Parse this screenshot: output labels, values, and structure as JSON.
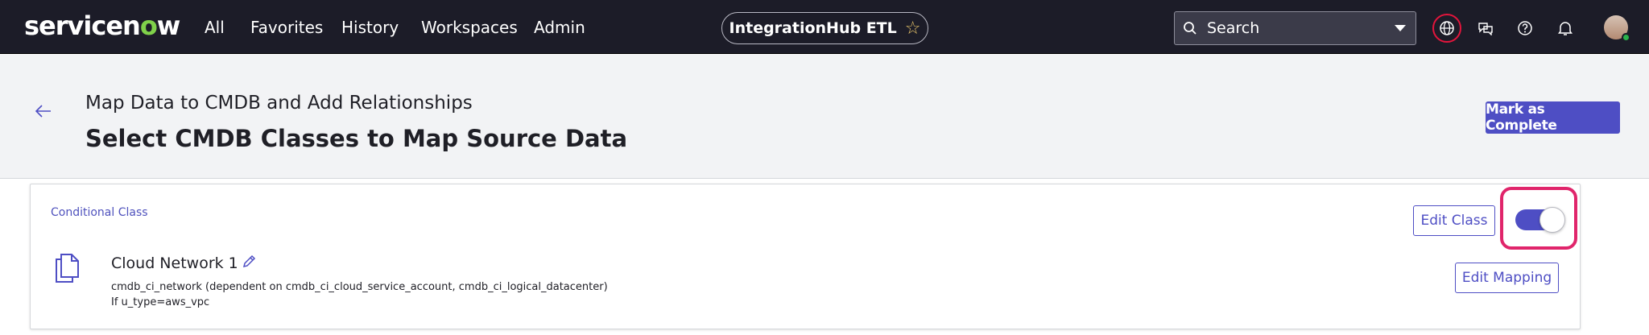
{
  "topbar": {
    "logo_prefix": "servicen",
    "logo_o": "o",
    "logo_suffix": "w",
    "nav": [
      "All",
      "Favorites",
      "History",
      "Workspaces",
      "Admin"
    ],
    "app_name": "IntegrationHub ETL",
    "search_placeholder": "Search"
  },
  "header": {
    "subtitle": "Map Data to CMDB and Add Relationships",
    "title": "Select CMDB Classes to Map Source Data",
    "complete_label": "Mark as Complete"
  },
  "card": {
    "section_label": "Conditional Class",
    "class_name": "Cloud Network 1",
    "class_table": "cmdb_ci_network (dependent on cmdb_ci_cloud_service_account, cmdb_ci_logical_datacenter)",
    "condition": "If u_type=aws_vpc",
    "edit_class_label": "Edit Class",
    "edit_mapping_label": "Edit Mapping",
    "toggle_on": true
  },
  "colors": {
    "accent": "#4e4ec4",
    "nav_bg": "#1c1c28",
    "highlight": "#e0256b"
  }
}
